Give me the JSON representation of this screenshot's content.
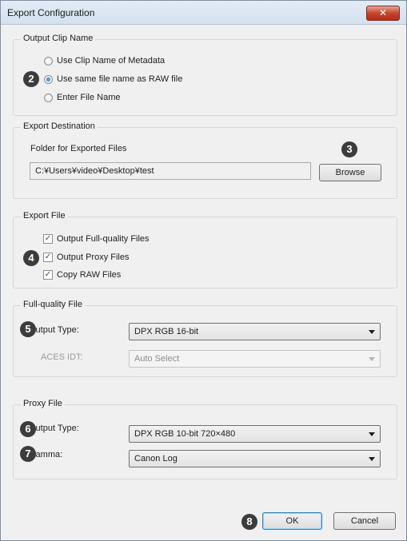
{
  "window": {
    "title": "Export Configuration",
    "close_label": "✕"
  },
  "output_clip_name": {
    "legend": "Output Clip Name",
    "options": [
      "Use Clip Name of Metadata",
      "Use same file name as RAW file",
      "Enter File Name"
    ],
    "selected_index": 1
  },
  "export_destination": {
    "legend": "Export Destination",
    "folder_label": "Folder for Exported Files",
    "folder_value": "C:¥Users¥video¥Desktop¥test",
    "browse_label": "Browse"
  },
  "export_file": {
    "legend": "Export File",
    "options": [
      {
        "label": "Output Full-quality Files",
        "checked": true
      },
      {
        "label": "Output Proxy Files",
        "checked": true
      },
      {
        "label": "Copy RAW Files",
        "checked": true
      }
    ]
  },
  "full_quality": {
    "legend": "Full-quality File",
    "output_type_label": "Output Type:",
    "output_type_value": "DPX RGB 16-bit",
    "aces_idt_label": "ACES IDT:",
    "aces_idt_value": "Auto Select"
  },
  "proxy": {
    "legend": "Proxy File",
    "output_type_label": "Output Type:",
    "output_type_value": "DPX RGB 10-bit 720×480",
    "gamma_label": "Gamma:",
    "gamma_value": "Canon Log"
  },
  "buttons": {
    "ok_label": "OK",
    "cancel_label": "Cancel"
  },
  "badges": [
    "2",
    "3",
    "4",
    "5",
    "6",
    "7",
    "8"
  ]
}
